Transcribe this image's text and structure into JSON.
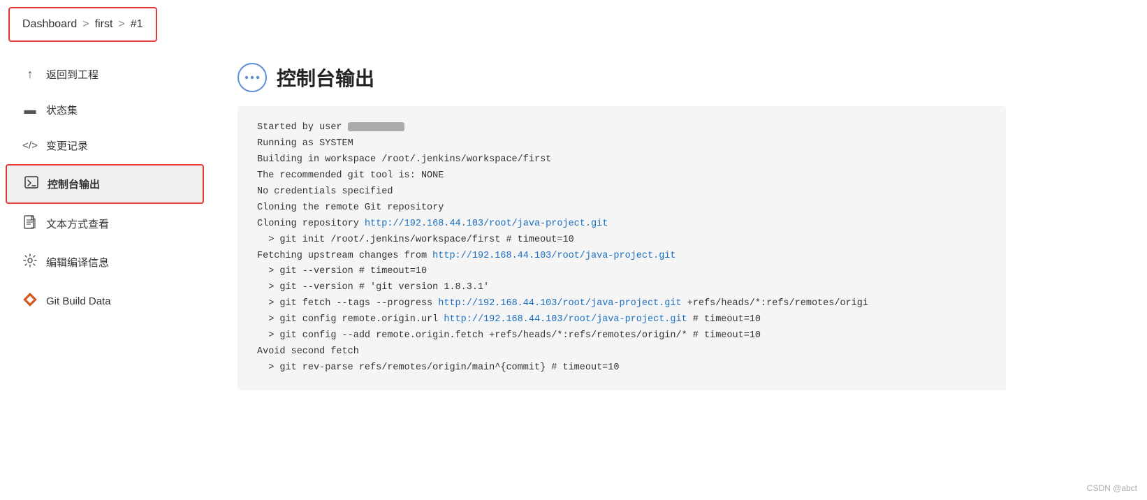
{
  "breadcrumb": {
    "items": [
      "Dashboard",
      "first",
      "#1"
    ],
    "separators": [
      ">",
      ">"
    ]
  },
  "sidebar": {
    "items": [
      {
        "id": "back",
        "icon": "↑",
        "label": "返回到工程",
        "active": false,
        "iconType": "arrow"
      },
      {
        "id": "stages",
        "icon": "≡",
        "label": "状态集",
        "active": false,
        "iconType": "doc"
      },
      {
        "id": "changes",
        "icon": "</>",
        "label": "变更记录",
        "active": false,
        "iconType": "code"
      },
      {
        "id": "console",
        "icon": ">_",
        "label": "控制台输出",
        "active": true,
        "iconType": "terminal"
      },
      {
        "id": "textview",
        "icon": "📄",
        "label": "文本方式查看",
        "active": false,
        "iconType": "file"
      },
      {
        "id": "editbuild",
        "icon": "⚙",
        "label": "编辑编译信息",
        "active": false,
        "iconType": "gear"
      },
      {
        "id": "gitbuild",
        "icon": "◆",
        "label": "Git Build Data",
        "active": false,
        "iconType": "diamond"
      }
    ]
  },
  "main": {
    "title": "控制台输出",
    "title_icon": "...",
    "console_lines": [
      {
        "type": "text",
        "content": "Started by user "
      },
      {
        "type": "text",
        "content": "Running as SYSTEM"
      },
      {
        "type": "text",
        "content": "Building in workspace /root/.jenkins/workspace/first"
      },
      {
        "type": "text",
        "content": "The recommended git tool is: NONE"
      },
      {
        "type": "text",
        "content": "No credentials specified"
      },
      {
        "type": "text",
        "content": "Cloning the remote Git repository"
      },
      {
        "type": "link_line",
        "before": "Cloning repository ",
        "url": "http://192.168.44.103/root/java-project.git",
        "after": ""
      },
      {
        "type": "text",
        "content": "  > git init /root/.jenkins/workspace/first # timeout=10"
      },
      {
        "type": "link_line",
        "before": "Fetching upstream changes from ",
        "url": "http://192.168.44.103/root/java-project.git",
        "after": ""
      },
      {
        "type": "text",
        "content": "  > git --version # timeout=10"
      },
      {
        "type": "text",
        "content": "  > git --version # 'git version 1.8.3.1'"
      },
      {
        "type": "link_line",
        "before": "  > git fetch --tags --progress ",
        "url": "http://192.168.44.103/root/java-project.git",
        "after": " +refs/heads/*:refs/remotes/origi"
      },
      {
        "type": "link_line",
        "before": "  > git config remote.origin.url ",
        "url": "http://192.168.44.103/root/java-project.git",
        "after": " # timeout=10"
      },
      {
        "type": "text",
        "content": "  > git config --add remote.origin.fetch +refs/heads/*:refs/remotes/origin/* # timeout=10"
      },
      {
        "type": "text",
        "content": "Avoid second fetch"
      },
      {
        "type": "text",
        "content": "  > git rev-parse refs/remotes/origin/main^{commit} # timeout=10"
      }
    ]
  },
  "watermark": "CSDN @abct"
}
